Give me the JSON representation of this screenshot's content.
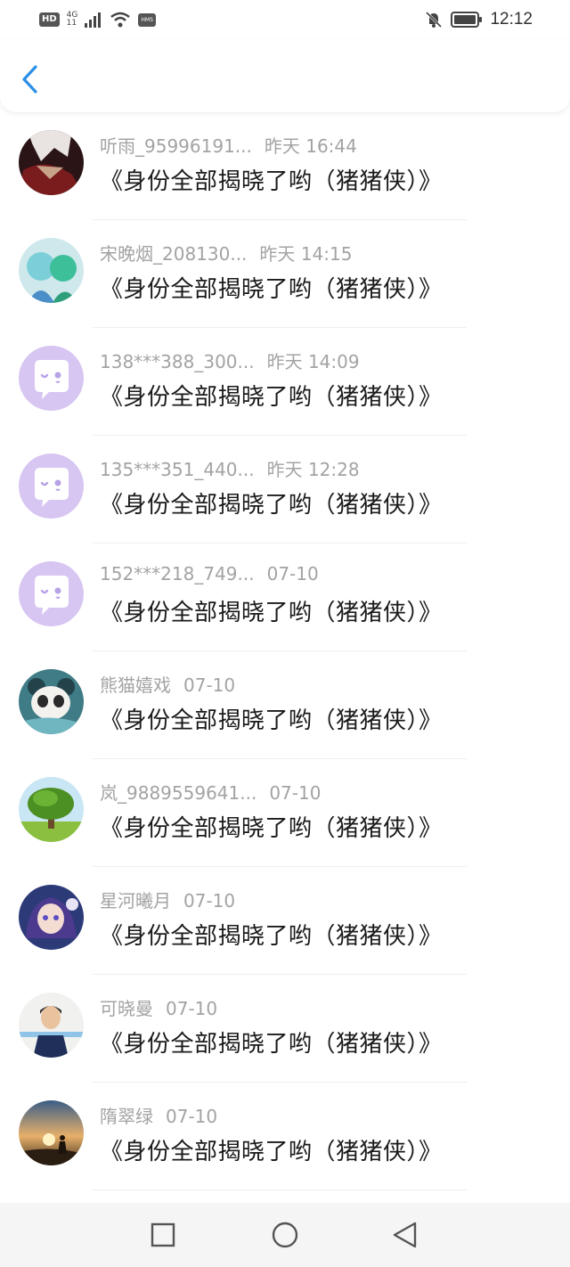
{
  "status_bar": {
    "hd": "HD",
    "network_type": "4G",
    "network_sub": "11",
    "hms": "HMS",
    "time": "12:12"
  },
  "header": {
    "back_icon": "chevron-left-icon"
  },
  "messages": [
    {
      "name": "听雨_95996191...",
      "time": "昨天 16:44",
      "title": "《身份全部揭晓了哟（猪猪侠）》",
      "avatar": "anime-dark"
    },
    {
      "name": "宋晚烟_208130...",
      "time": "昨天 14:15",
      "title": "《身份全部揭晓了哟（猪猪侠）》",
      "avatar": "anime-teal"
    },
    {
      "name": "138***388_300...",
      "time": "昨天 14:09",
      "title": "《身份全部揭晓了哟（猪猪侠）》",
      "avatar": "default-chat"
    },
    {
      "name": "135***351_440...",
      "time": "昨天 12:28",
      "title": "《身份全部揭晓了哟（猪猪侠）》",
      "avatar": "default-chat"
    },
    {
      "name": "152***218_749...",
      "time": "07-10",
      "title": "《身份全部揭晓了哟（猪猪侠）》",
      "avatar": "default-chat"
    },
    {
      "name": "熊猫嬉戏",
      "time": "07-10",
      "title": "《身份全部揭晓了哟（猪猪侠）》",
      "avatar": "panda"
    },
    {
      "name": "岚_9889559641...",
      "time": "07-10",
      "title": "《身份全部揭晓了哟（猪猪侠）》",
      "avatar": "tree"
    },
    {
      "name": "星河曦月",
      "time": "07-10",
      "title": "《身份全部揭晓了哟（猪猪侠）》",
      "avatar": "anime-purple"
    },
    {
      "name": "可晓曼",
      "time": "07-10",
      "title": "《身份全部揭晓了哟（猪猪侠）》",
      "avatar": "person"
    },
    {
      "name": "隋翠绿",
      "time": "07-10",
      "title": "《身份全部揭晓了哟（猪猪侠）》",
      "avatar": "sunset"
    }
  ],
  "nav_bar": {
    "buttons": [
      "recent-apps-icon",
      "home-icon",
      "back-triangle-icon"
    ]
  },
  "colors": {
    "accent": "#2b8fe6",
    "default_avatar_bg": "#d7c5f2",
    "muted_text": "#a3a3a3"
  }
}
